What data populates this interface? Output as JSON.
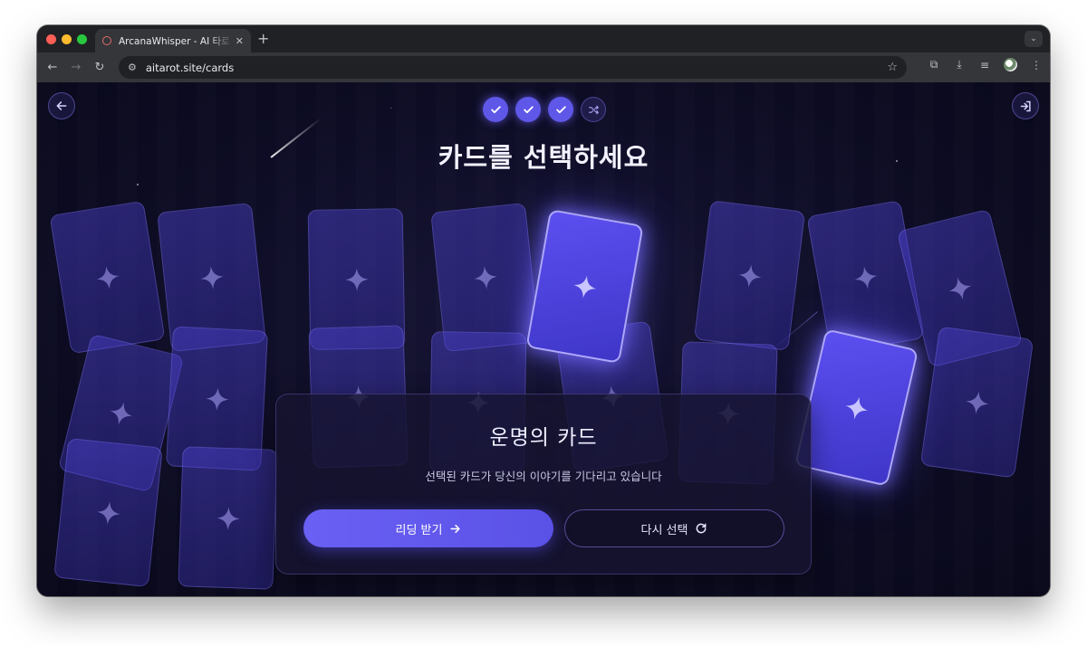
{
  "browser": {
    "tab_title": "ArcanaWhisper - AI 타로 리딩",
    "url": "aitarot.site/cards"
  },
  "page": {
    "title": "카드를 선택하세요",
    "steps": [
      {
        "state": "done",
        "icon": "check-icon"
      },
      {
        "state": "done",
        "icon": "check-icon"
      },
      {
        "state": "done",
        "icon": "check-icon"
      },
      {
        "state": "current",
        "icon": "shuffle-icon"
      }
    ]
  },
  "panel": {
    "title": "운명의 카드",
    "subtitle": "선택된 카드가 당신의 이야기를 기다리고 있습니다",
    "primary_button": "리딩 받기",
    "secondary_button": "다시 선택"
  },
  "colors": {
    "accent": "#5f57e8",
    "background": "#0d0c24",
    "card": "#4e44d2"
  }
}
